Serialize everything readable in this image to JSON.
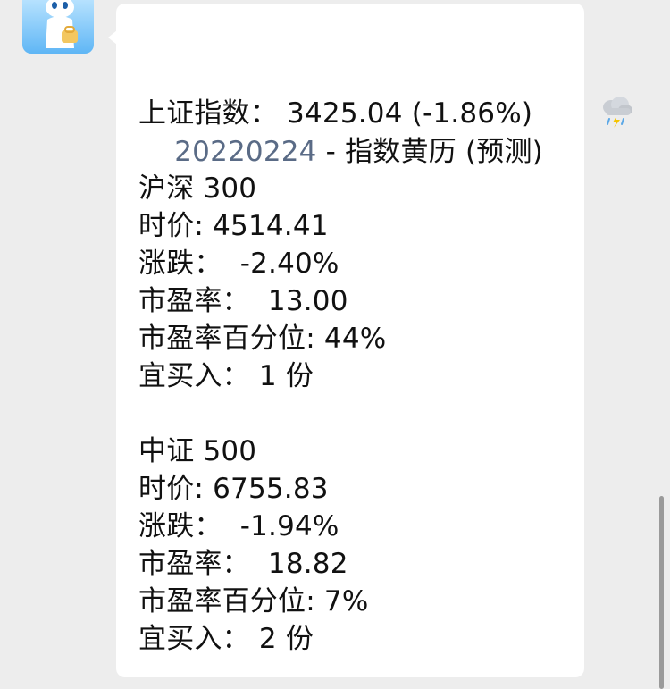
{
  "message": {
    "title_date": "20220224",
    "title_sep": " - ",
    "title_text": "指数黄历 (预测)",
    "weather_icon": "thunderstorm-rain-icon",
    "sse": "上证指数： 3425.04 (-1.86%)",
    "hs300": {
      "name": "沪深 300",
      "price": "时价: 4514.41",
      "change": "涨跌：  -2.40%",
      "pe": "市盈率：  13.00",
      "pe_pct": "市盈率百分位: 44%",
      "buy": "宜买入： 1 份"
    },
    "zz500": {
      "name": "中证 500",
      "price": "时价: 6755.83",
      "change": "涨跌：  -1.94%",
      "pe": "市盈率：  18.82",
      "pe_pct": "市盈率百分位: 7%",
      "buy": "宜买入： 2 份"
    }
  },
  "colors": {
    "bubble": "#ffffff",
    "background": "#ededed",
    "date_link": "#5a6b86"
  }
}
